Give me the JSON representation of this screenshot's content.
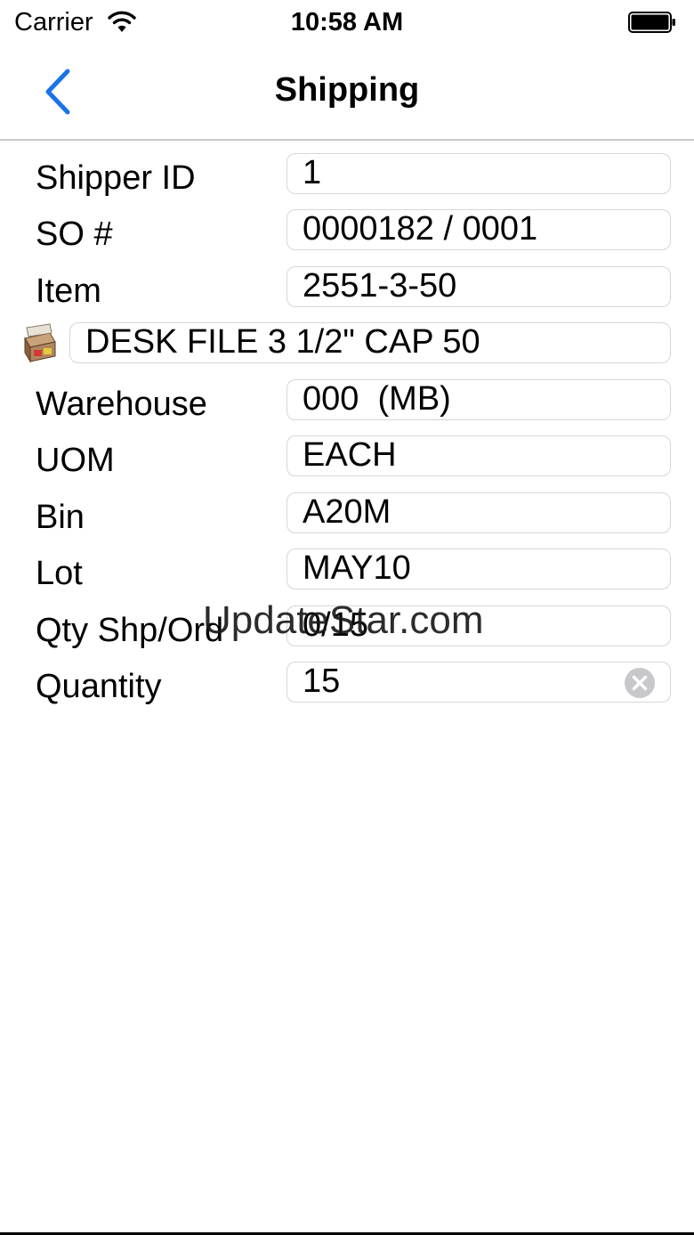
{
  "status_bar": {
    "carrier": "Carrier",
    "time": "10:58 AM"
  },
  "nav": {
    "title": "Shipping",
    "back_icon": "chevron-left-icon",
    "accent_color": "#1a73e8"
  },
  "form": {
    "shipper_id": {
      "label": "Shipper ID",
      "value": "1"
    },
    "so_number": {
      "label": "SO #",
      "value": "0000182 / 0001"
    },
    "item": {
      "label": "Item",
      "value": "2551-3-50"
    },
    "description": {
      "icon": "file-box-icon",
      "value": "DESK FILE 3 1/2\" CAP 50"
    },
    "warehouse": {
      "label": "Warehouse",
      "value": "000  (MB)"
    },
    "uom": {
      "label": "UOM",
      "value": "EACH"
    },
    "bin": {
      "label": "Bin",
      "value": "A20M"
    },
    "lot": {
      "label": "Lot",
      "value": "MAY10"
    },
    "qty_shp_ord": {
      "label": "Qty Shp/Ord",
      "value": "0/15"
    },
    "quantity": {
      "label": "Quantity",
      "value": "15",
      "clear_icon": "clear-icon"
    }
  },
  "watermark": "UpdateStar.com"
}
